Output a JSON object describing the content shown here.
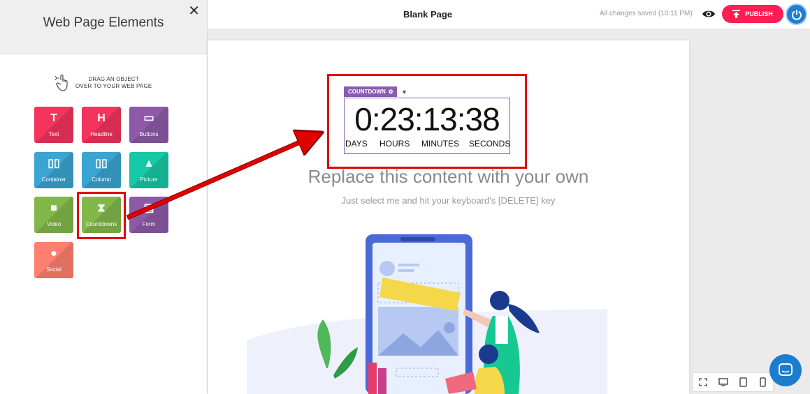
{
  "sidebar": {
    "title": "Web Page Elements",
    "close_label": "✕",
    "drag_hint_line1": "DRAG AN OBJECT",
    "drag_hint_line2": "OVER TO YOUR WEB PAGE",
    "tiles": [
      {
        "label": "Text",
        "glyph": "T",
        "color": "#f4345c"
      },
      {
        "label": "Headline",
        "glyph": "H",
        "color": "#f4345c"
      },
      {
        "label": "Buttons",
        "glyph": "▭",
        "color": "#8e5aa7"
      },
      {
        "label": "Container",
        "glyph": "▯▯",
        "color": "#3aa5d2"
      },
      {
        "label": "Column",
        "glyph": "▯▯",
        "color": "#3aa5d2"
      },
      {
        "label": "Picture",
        "glyph": "▲",
        "color": "#16c8a5"
      },
      {
        "label": "Video",
        "glyph": "■",
        "color": "#82b84a"
      },
      {
        "label": "Countdowns",
        "glyph": "⧗",
        "color": "#82b84a"
      },
      {
        "label": "Form",
        "glyph": "▤",
        "color": "#8e5aa7"
      },
      {
        "label": "Social",
        "glyph": "●",
        "color": "#ff8070"
      }
    ]
  },
  "topbar": {
    "page_title": "Blank Page",
    "save_status": "All changes saved (10:11 PM)",
    "publish_label": "PUBLISH"
  },
  "countdown": {
    "tag_label": "COUNTDOWN",
    "digits": "0:23:13:38",
    "labels": {
      "days": "DAYS",
      "hours": "HOURS",
      "minutes": "MINUTES",
      "seconds": "SECONDS"
    }
  },
  "content": {
    "title": "Replace this content with your own",
    "subtitle": "Just select me and hit your keyboard's [DELETE] key"
  },
  "colors": {
    "accent_red": "#ff1e54",
    "countdown_purple": "#8a5bb0",
    "annotation_red": "#e10000",
    "brand_blue": "#1d7ed4"
  }
}
